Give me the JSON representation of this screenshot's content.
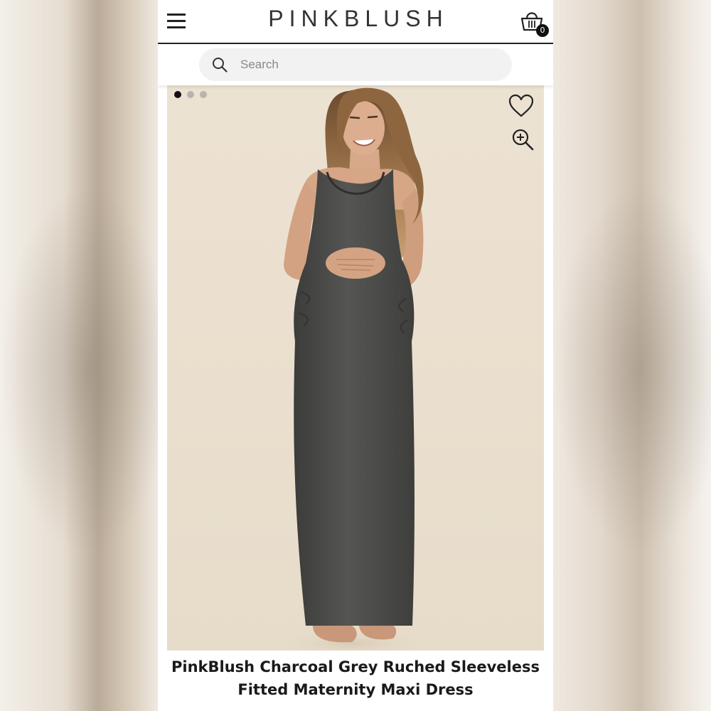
{
  "header": {
    "brand": "PINKBLUSH",
    "cart_count": "0"
  },
  "search": {
    "placeholder": "Search"
  },
  "gallery": {
    "total_images": 3,
    "active_index": 0
  },
  "product": {
    "title_line1": "PinkBlush Charcoal Grey Ruched Sleeveless",
    "title_line2": "Fitted Maternity Maxi Dress"
  },
  "icons": {
    "menu": "hamburger-menu-icon",
    "cart": "shopping-bag-icon",
    "search": "search-icon",
    "wishlist": "heart-icon",
    "zoom": "zoom-in-icon"
  },
  "colors": {
    "dress": "#4a4a48",
    "backdrop": "#ebe0cf",
    "text": "#1a1a1a"
  }
}
